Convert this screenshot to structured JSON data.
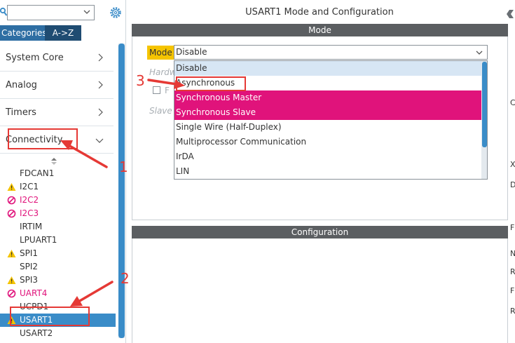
{
  "left_panel": {
    "search": {
      "value": "",
      "placeholder": ""
    },
    "tabs": {
      "categories": "Categories",
      "az": "A->Z"
    },
    "categories": [
      {
        "label": "System Core"
      },
      {
        "label": "Analog"
      },
      {
        "label": "Timers"
      },
      {
        "label": "Connectivity"
      }
    ],
    "peripherals": [
      {
        "label": "FDCAN1",
        "status": "none"
      },
      {
        "label": "I2C1",
        "status": "warning"
      },
      {
        "label": "I2C2",
        "status": "error"
      },
      {
        "label": "I2C3",
        "status": "error"
      },
      {
        "label": "IRTIM",
        "status": "none"
      },
      {
        "label": "LPUART1",
        "status": "none"
      },
      {
        "label": "SPI1",
        "status": "warning"
      },
      {
        "label": "SPI2",
        "status": "none"
      },
      {
        "label": "SPI3",
        "status": "warning"
      },
      {
        "label": "UART4",
        "status": "error"
      },
      {
        "label": "UCPD1",
        "status": "none"
      },
      {
        "label": "USART1",
        "status": "warning",
        "selected": true
      },
      {
        "label": "USART2",
        "status": "none"
      }
    ]
  },
  "main": {
    "title": "USART1 Mode and Configuration",
    "mode_header": "Mode",
    "mode_label": "Mode",
    "mode_value": "Disable",
    "ghost_hardware": "Hardw",
    "ghost_checkbox_label": "F",
    "ghost_slave": "Slave",
    "dropdown_options": [
      {
        "label": "Disable",
        "style": "highlight"
      },
      {
        "label": "Asynchronous",
        "style": "normal"
      },
      {
        "label": "Synchronous Master",
        "style": "pink"
      },
      {
        "label": "Synchronous Slave",
        "style": "pink"
      },
      {
        "label": "Single Wire (Half-Duplex)",
        "style": "normal"
      },
      {
        "label": "Multiprocessor Communication",
        "style": "normal"
      },
      {
        "label": "IrDA",
        "style": "normal"
      },
      {
        "label": "LIN",
        "style": "normal"
      }
    ],
    "config_header": "Configuration"
  },
  "annotations": {
    "n1": "1",
    "n2": "2",
    "n3": "3"
  },
  "edge_chars": [
    "C",
    "X",
    "D",
    "F",
    "N",
    "R",
    "F",
    "R"
  ],
  "colors": {
    "selected": "#3a8cc8",
    "error": "#e0137b",
    "warning": "#f5c400",
    "annotation": "#e53935",
    "header": "#5b5e61"
  }
}
